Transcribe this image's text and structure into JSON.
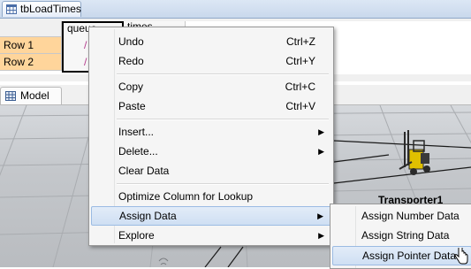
{
  "table_window": {
    "tab_title": "tbLoadTimes",
    "columns": [
      "queue",
      "times"
    ],
    "rows": [
      {
        "label": "Row 1",
        "queue": "/"
      },
      {
        "label": "Row 2",
        "queue": "/"
      }
    ]
  },
  "model_window": {
    "tab_title": "Model",
    "object_label": "Transporter1"
  },
  "context_menu": {
    "items": [
      {
        "label": "Undo",
        "shortcut": "Ctrl+Z"
      },
      {
        "label": "Redo",
        "shortcut": "Ctrl+Y"
      },
      {
        "label": "Copy",
        "shortcut": "Ctrl+C"
      },
      {
        "label": "Paste",
        "shortcut": "Ctrl+V"
      },
      {
        "label": "Insert...",
        "has_submenu": true
      },
      {
        "label": "Delete...",
        "has_submenu": true
      },
      {
        "label": "Clear Data"
      },
      {
        "label": "Optimize Column for Lookup"
      },
      {
        "label": "Assign Data",
        "has_submenu": true,
        "highlighted": true
      },
      {
        "label": "Explore",
        "has_submenu": true
      }
    ],
    "submenu": {
      "items": [
        {
          "label": "Assign Number Data"
        },
        {
          "label": "Assign String Data"
        },
        {
          "label": "Assign Pointer Data",
          "highlighted": true
        }
      ]
    }
  },
  "colors": {
    "row_header": "#ffd59b",
    "highlight": "#cfdff3",
    "highlight_border": "#9bbbe3"
  }
}
